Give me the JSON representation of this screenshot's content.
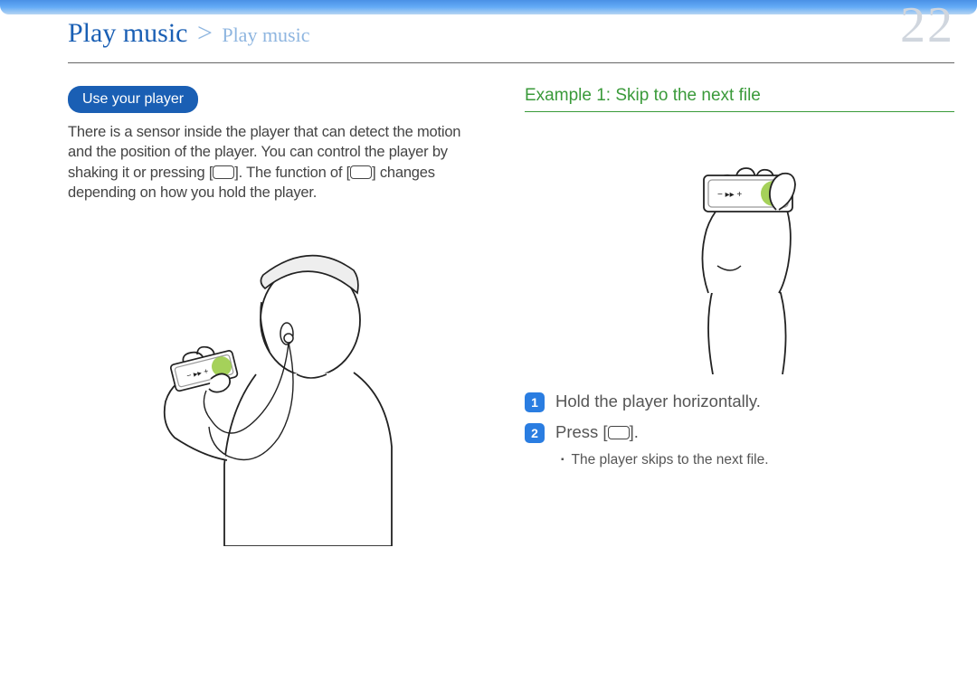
{
  "header": {
    "breadcrumb_main": "Play music",
    "breadcrumb_sep": ">",
    "breadcrumb_sub": "Play music",
    "page_number": "22"
  },
  "left": {
    "pill_heading": "Use your player",
    "body_text_1": "There is a sensor inside the player that can detect the motion and the position of the player. You can control the player by shaking it or pressing [",
    "body_text_2": "]. The function of [",
    "body_text_3": "] changes depending on how you hold the player."
  },
  "right": {
    "example_heading": "Example 1: Skip to the next file",
    "steps": [
      {
        "num": "1",
        "text": "Hold the player horizontally."
      },
      {
        "num": "2",
        "text_pre": "Press [",
        "text_post": "]."
      }
    ],
    "sub_bullet": "The player skips to the next file."
  }
}
